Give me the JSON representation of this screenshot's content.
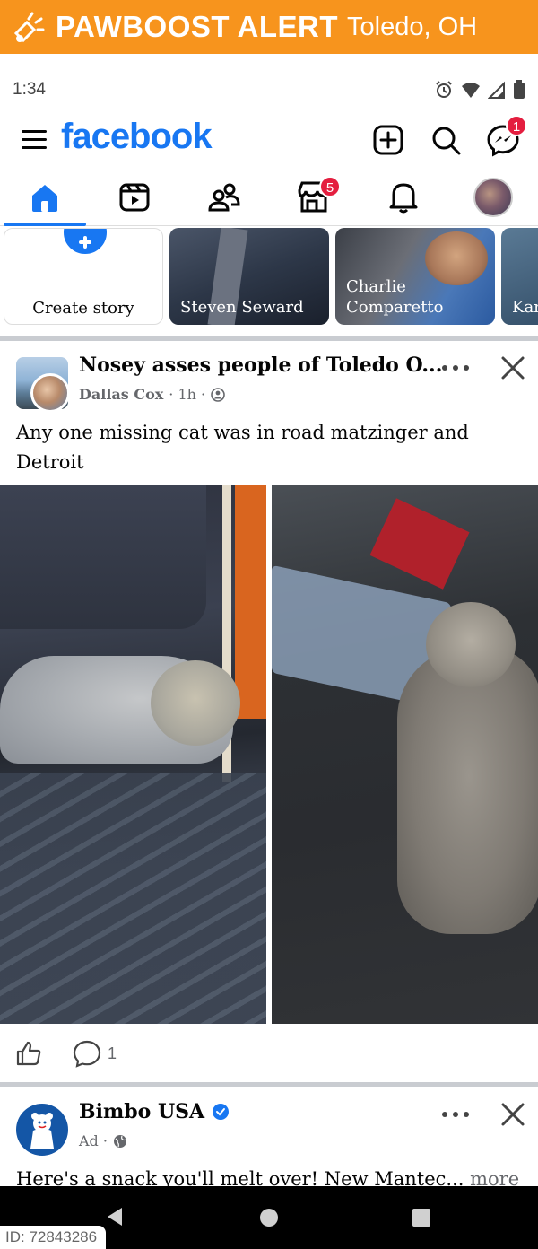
{
  "banner": {
    "title": "PAWBOOST ALERT",
    "location": "Toledo, OH",
    "color": "#f7941d"
  },
  "status_bar": {
    "time": "1:34",
    "icons": [
      "alarm-icon",
      "wifi-icon",
      "signal-icon",
      "battery-icon"
    ]
  },
  "header": {
    "logo": "facebook",
    "brand_color": "#1877f2",
    "actions": [
      "add-icon",
      "search-icon",
      "messenger-icon"
    ],
    "messenger_badge": "1"
  },
  "nav": {
    "tabs": [
      "home-tab",
      "video-tab",
      "friends-tab",
      "marketplace-tab",
      "notifications-tab",
      "profile-tab"
    ],
    "marketplace_badge": "5"
  },
  "stories": [
    {
      "label": "Create story"
    },
    {
      "label": "Steven Seward"
    },
    {
      "label": "Charlie\nComparetto"
    },
    {
      "label": "Kar"
    }
  ],
  "post": {
    "group": "Nosey asses people of Toledo O...",
    "author": "Dallas Cox",
    "time": "· 1h ·",
    "text": "Any one missing cat was in road matzinger and Detroit",
    "comment_count": "1"
  },
  "ad": {
    "name": "Bimbo USA",
    "meta": "Ad ·",
    "text": "Here's a snack you'll melt over! New Mantec...",
    "more": "more"
  },
  "id_tag": "ID: 72843286"
}
